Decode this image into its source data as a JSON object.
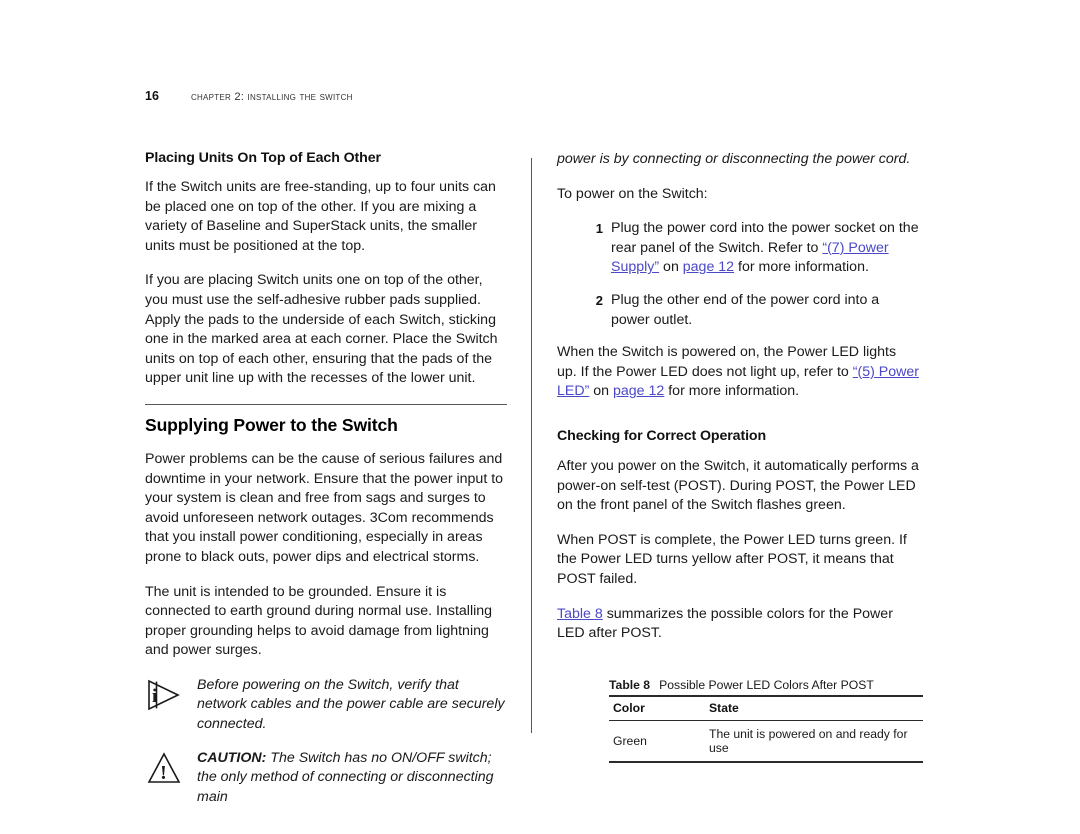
{
  "header": {
    "page_number": "16",
    "chapter_title": "Chapter 2: Installing the Switch"
  },
  "left_column": {
    "heading_1": "Placing Units On Top of Each Other",
    "para_1": "If the Switch units are free-standing, up to four units can be placed one on top of the other. If you are mixing a variety of Baseline and SuperStack units, the smaller units must be positioned at the top.",
    "para_2": "If you are placing Switch units one on top of the other, you must use the self-adhesive rubber pads supplied. Apply the pads to the underside of each Switch, sticking one in the marked area at each corner. Place the Switch units on top of each other, ensuring that the pads of the upper unit line up with the recesses of the lower unit.",
    "heading_2": "Supplying Power to the Switch",
    "para_3": "Power problems can be the cause of serious failures and downtime in your network. Ensure that the power input to your system is clean and free from sags and surges to avoid unforeseen network outages. 3Com recommends that you install power conditioning, especially in areas prone to black outs, power dips and electrical storms.",
    "para_4": "The unit is intended to be grounded. Ensure it is connected to earth ground during normal use. Installing proper grounding helps to avoid damage from lightning and power surges.",
    "note": {
      "icon": "info-triangle-icon",
      "text": "Before powering on the Switch, verify that network cables and the power cable are securely connected."
    },
    "caution": {
      "icon": "warning-triangle-icon",
      "lead": "CAUTION:",
      "text": " The Switch has no ON/OFF switch; the only method of connecting or disconnecting main"
    }
  },
  "right_column": {
    "continued_italic": "power is by connecting or disconnecting the power cord.",
    "intro": "To power on the Switch:",
    "steps": [
      {
        "number": "1",
        "text_before": "Plug the power cord into the power socket on the rear panel of the Switch. Refer to ",
        "link_1": "“(7) Power Supply”",
        "text_mid": " on ",
        "link_2": "page 12",
        "text_after": " for more information."
      },
      {
        "number": "2",
        "text_before": "Plug the other end of the power cord into a power outlet.",
        "link_1": "",
        "text_mid": "",
        "link_2": "",
        "text_after": ""
      }
    ],
    "para_led_before": "When the Switch is powered on, the Power LED lights up. If the Power LED does not light up, refer to ",
    "para_led_link1": "“(5) Power LED”",
    "para_led_mid": " on ",
    "para_led_link2": "page 12",
    "para_led_after": " for more information.",
    "heading": "Checking for Correct Operation",
    "para_post_1": "After you power on the Switch, it automatically performs a power-on self-test (POST). During POST, the Power LED on the front panel of the Switch flashes green.",
    "para_post_2": "When POST is complete, the Power LED turns green. If the Power LED turns yellow after POST, it means that POST failed.",
    "para_table_link": "Table 8",
    "para_table_after": " summarizes the possible colors for the Power LED after POST.",
    "table": {
      "caption_number": "Table 8",
      "caption_text": "Possible Power LED Colors After POST",
      "columns": [
        "Color",
        "State"
      ],
      "rows": [
        [
          "Green",
          "The unit is powered on and ready for use"
        ]
      ]
    }
  },
  "colors": {
    "link": "#4b48c8",
    "rule": "#56565a",
    "text": "#1a1a1a"
  }
}
